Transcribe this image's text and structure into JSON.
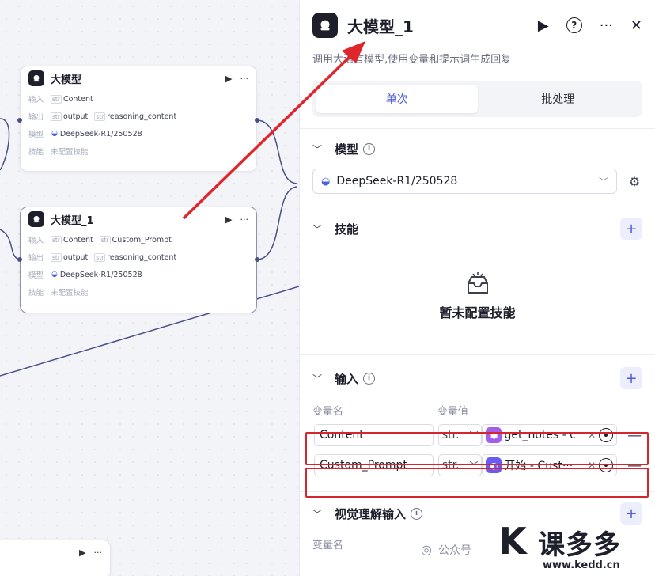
{
  "canvas": {
    "nodes": [
      {
        "title": "大模型",
        "input_label": "输入",
        "inputs": [
          "Content"
        ],
        "output_label": "输出",
        "outputs": [
          "output",
          "reasoning_content"
        ],
        "model_label": "模型",
        "model": "DeepSeek-R1/250528",
        "skill_label": "技能",
        "skill": "未配置技能"
      },
      {
        "title": "大模型_1",
        "input_label": "输入",
        "inputs": [
          "Content",
          "Custom_Prompt"
        ],
        "output_label": "输出",
        "outputs": [
          "output",
          "reasoning_content"
        ],
        "model_label": "模型",
        "model": "DeepSeek-R1/250528",
        "skill_label": "技能",
        "skill": "未配置技能"
      }
    ],
    "type_tag": "str"
  },
  "panel": {
    "title": "大模型_1",
    "subtitle": "调用大语言模型,使用变量和提示词生成回复",
    "tabs": [
      {
        "label": "单次",
        "active": true
      },
      {
        "label": "批处理",
        "active": false
      }
    ],
    "model_section": {
      "title": "模型",
      "value": "DeepSeek-R1/250528"
    },
    "skills_section": {
      "title": "技能",
      "empty_text": "暂未配置技能"
    },
    "input_section": {
      "title": "输入",
      "col_name": "变量名",
      "col_value": "变量值",
      "rows": [
        {
          "name": "Content",
          "type": "str.",
          "value": "get_notes - c",
          "value_color": "#a25ee8"
        },
        {
          "name": "Custom_Prompt",
          "type": "str.",
          "value": "开始 - Cust···",
          "value_color": "#6a5cf0"
        }
      ]
    },
    "visual_section": {
      "title": "视觉理解输入",
      "col_name": "变量名"
    }
  },
  "watermark": {
    "left": "公众号",
    "brand": "课多多",
    "url": "www.kedd.cn"
  },
  "colors": {
    "accent": "#4e5bd6",
    "highlight": "#d4262c",
    "arrow": "#e0262c"
  }
}
